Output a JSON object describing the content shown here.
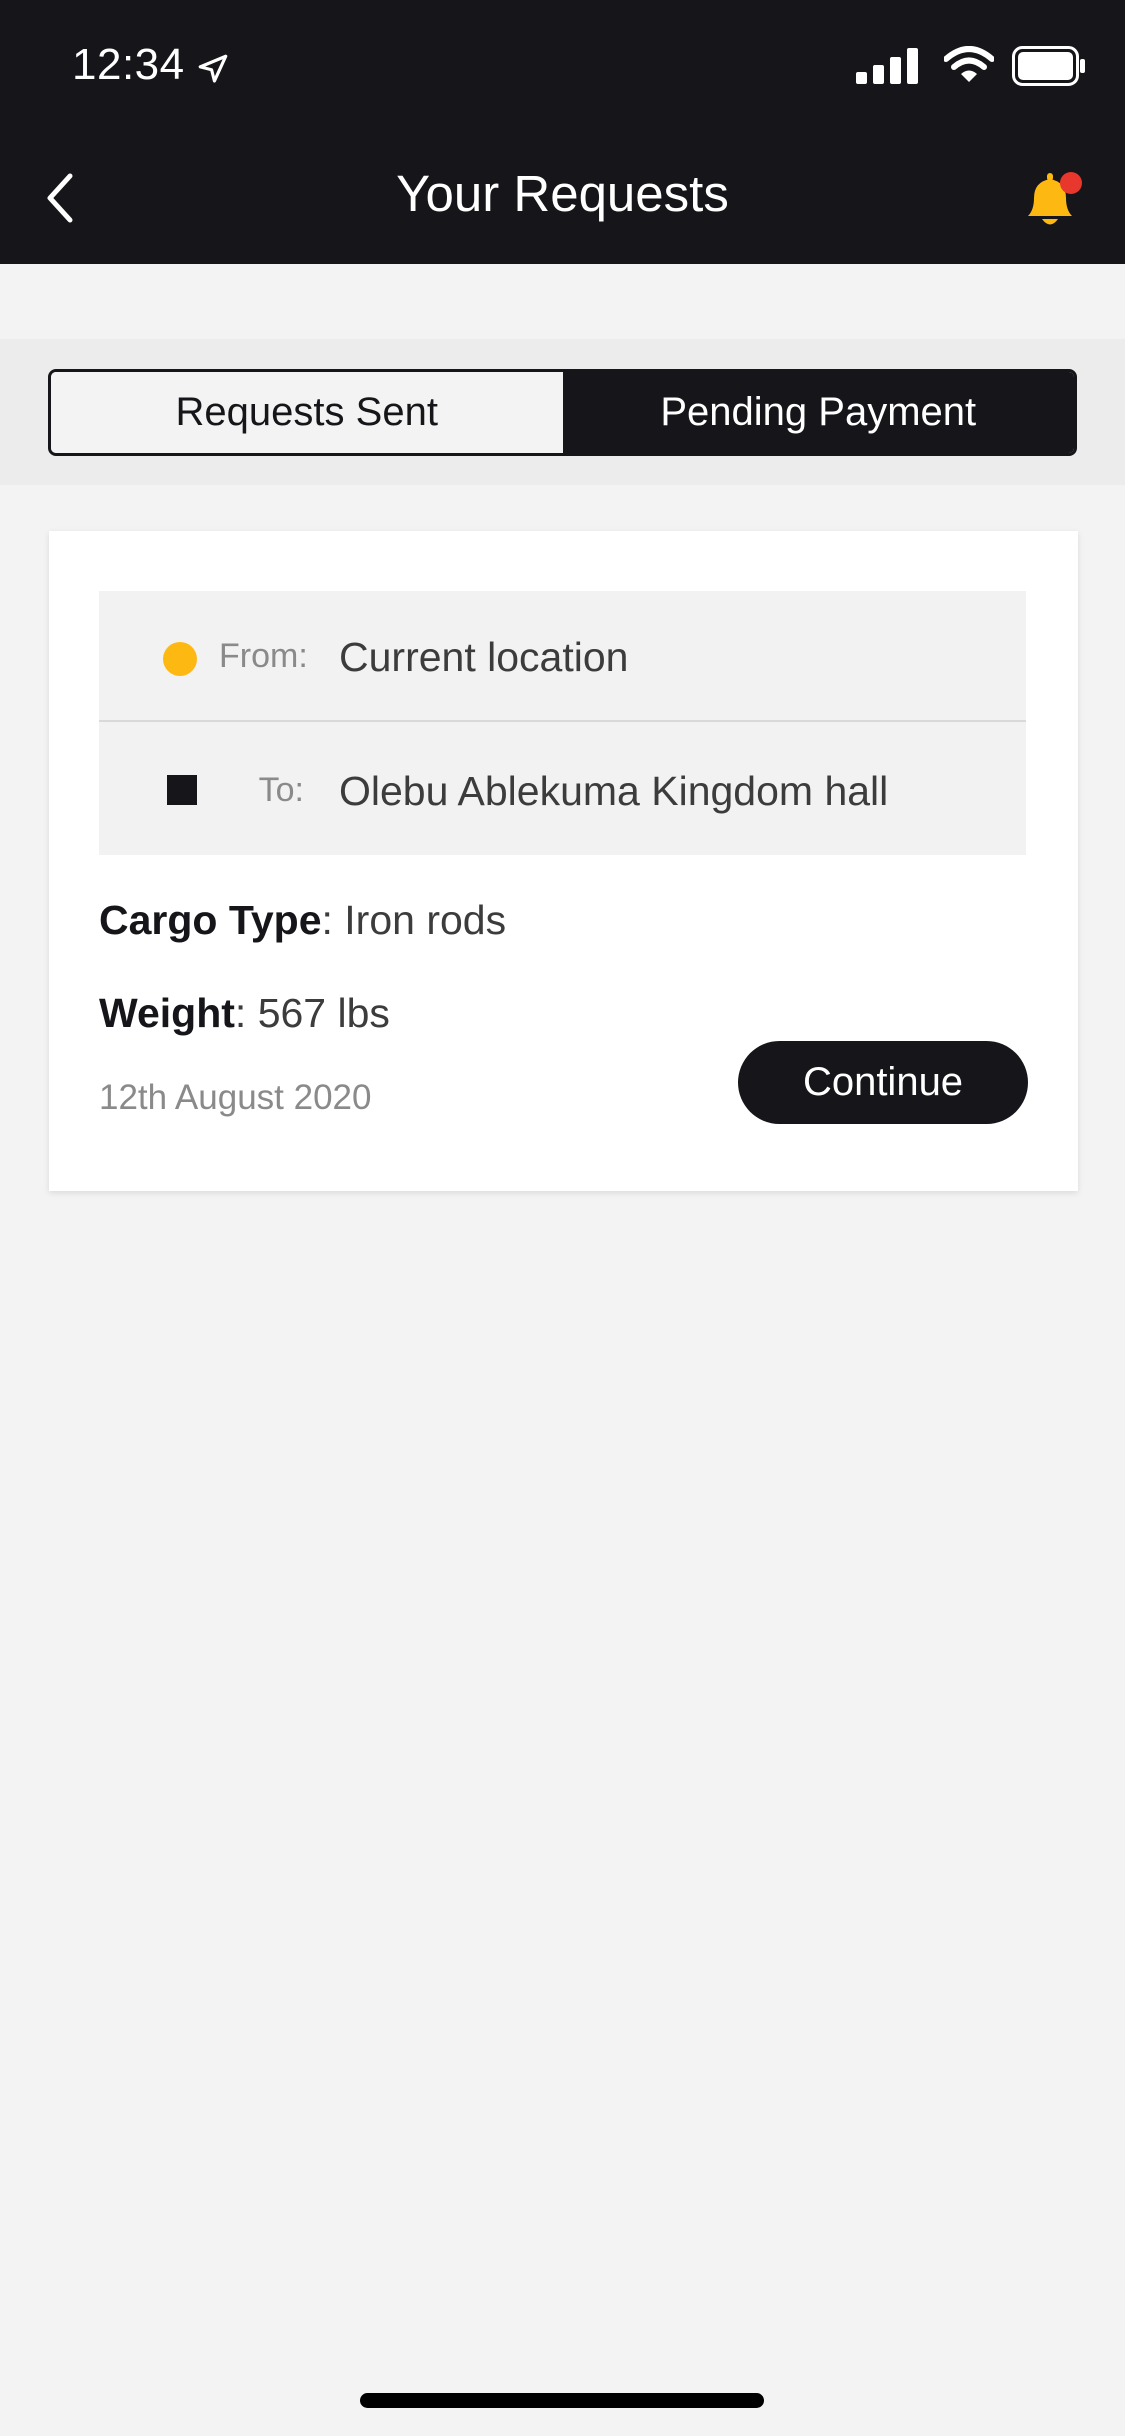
{
  "status_bar": {
    "time": "12:34",
    "icons": [
      "location-arrow-icon",
      "signal-icon",
      "wifi-icon",
      "battery-icon"
    ]
  },
  "nav": {
    "title": "Your Requests",
    "back_icon": "chevron-left-icon",
    "notification_icon": "bell-icon",
    "has_unread_badge": true
  },
  "tabs": [
    {
      "label": "Requests Sent",
      "selected": false
    },
    {
      "label": "Pending Payment",
      "selected": true
    }
  ],
  "request": {
    "from_label": "From:",
    "from_value": "Current location",
    "to_label": "To:",
    "to_value": "Olebu Ablekuma Kingdom hall",
    "cargo_label": "Cargo Type",
    "cargo_value": ": Iron rods",
    "weight_label": "Weight",
    "weight_value": ": 567 lbs",
    "date": "12th August 2020",
    "action_label": "Continue"
  },
  "colors": {
    "dark": "#16161a",
    "accent_yellow": "#fdb812",
    "badge_red": "#e8372c",
    "background": "#f3f3f3"
  }
}
